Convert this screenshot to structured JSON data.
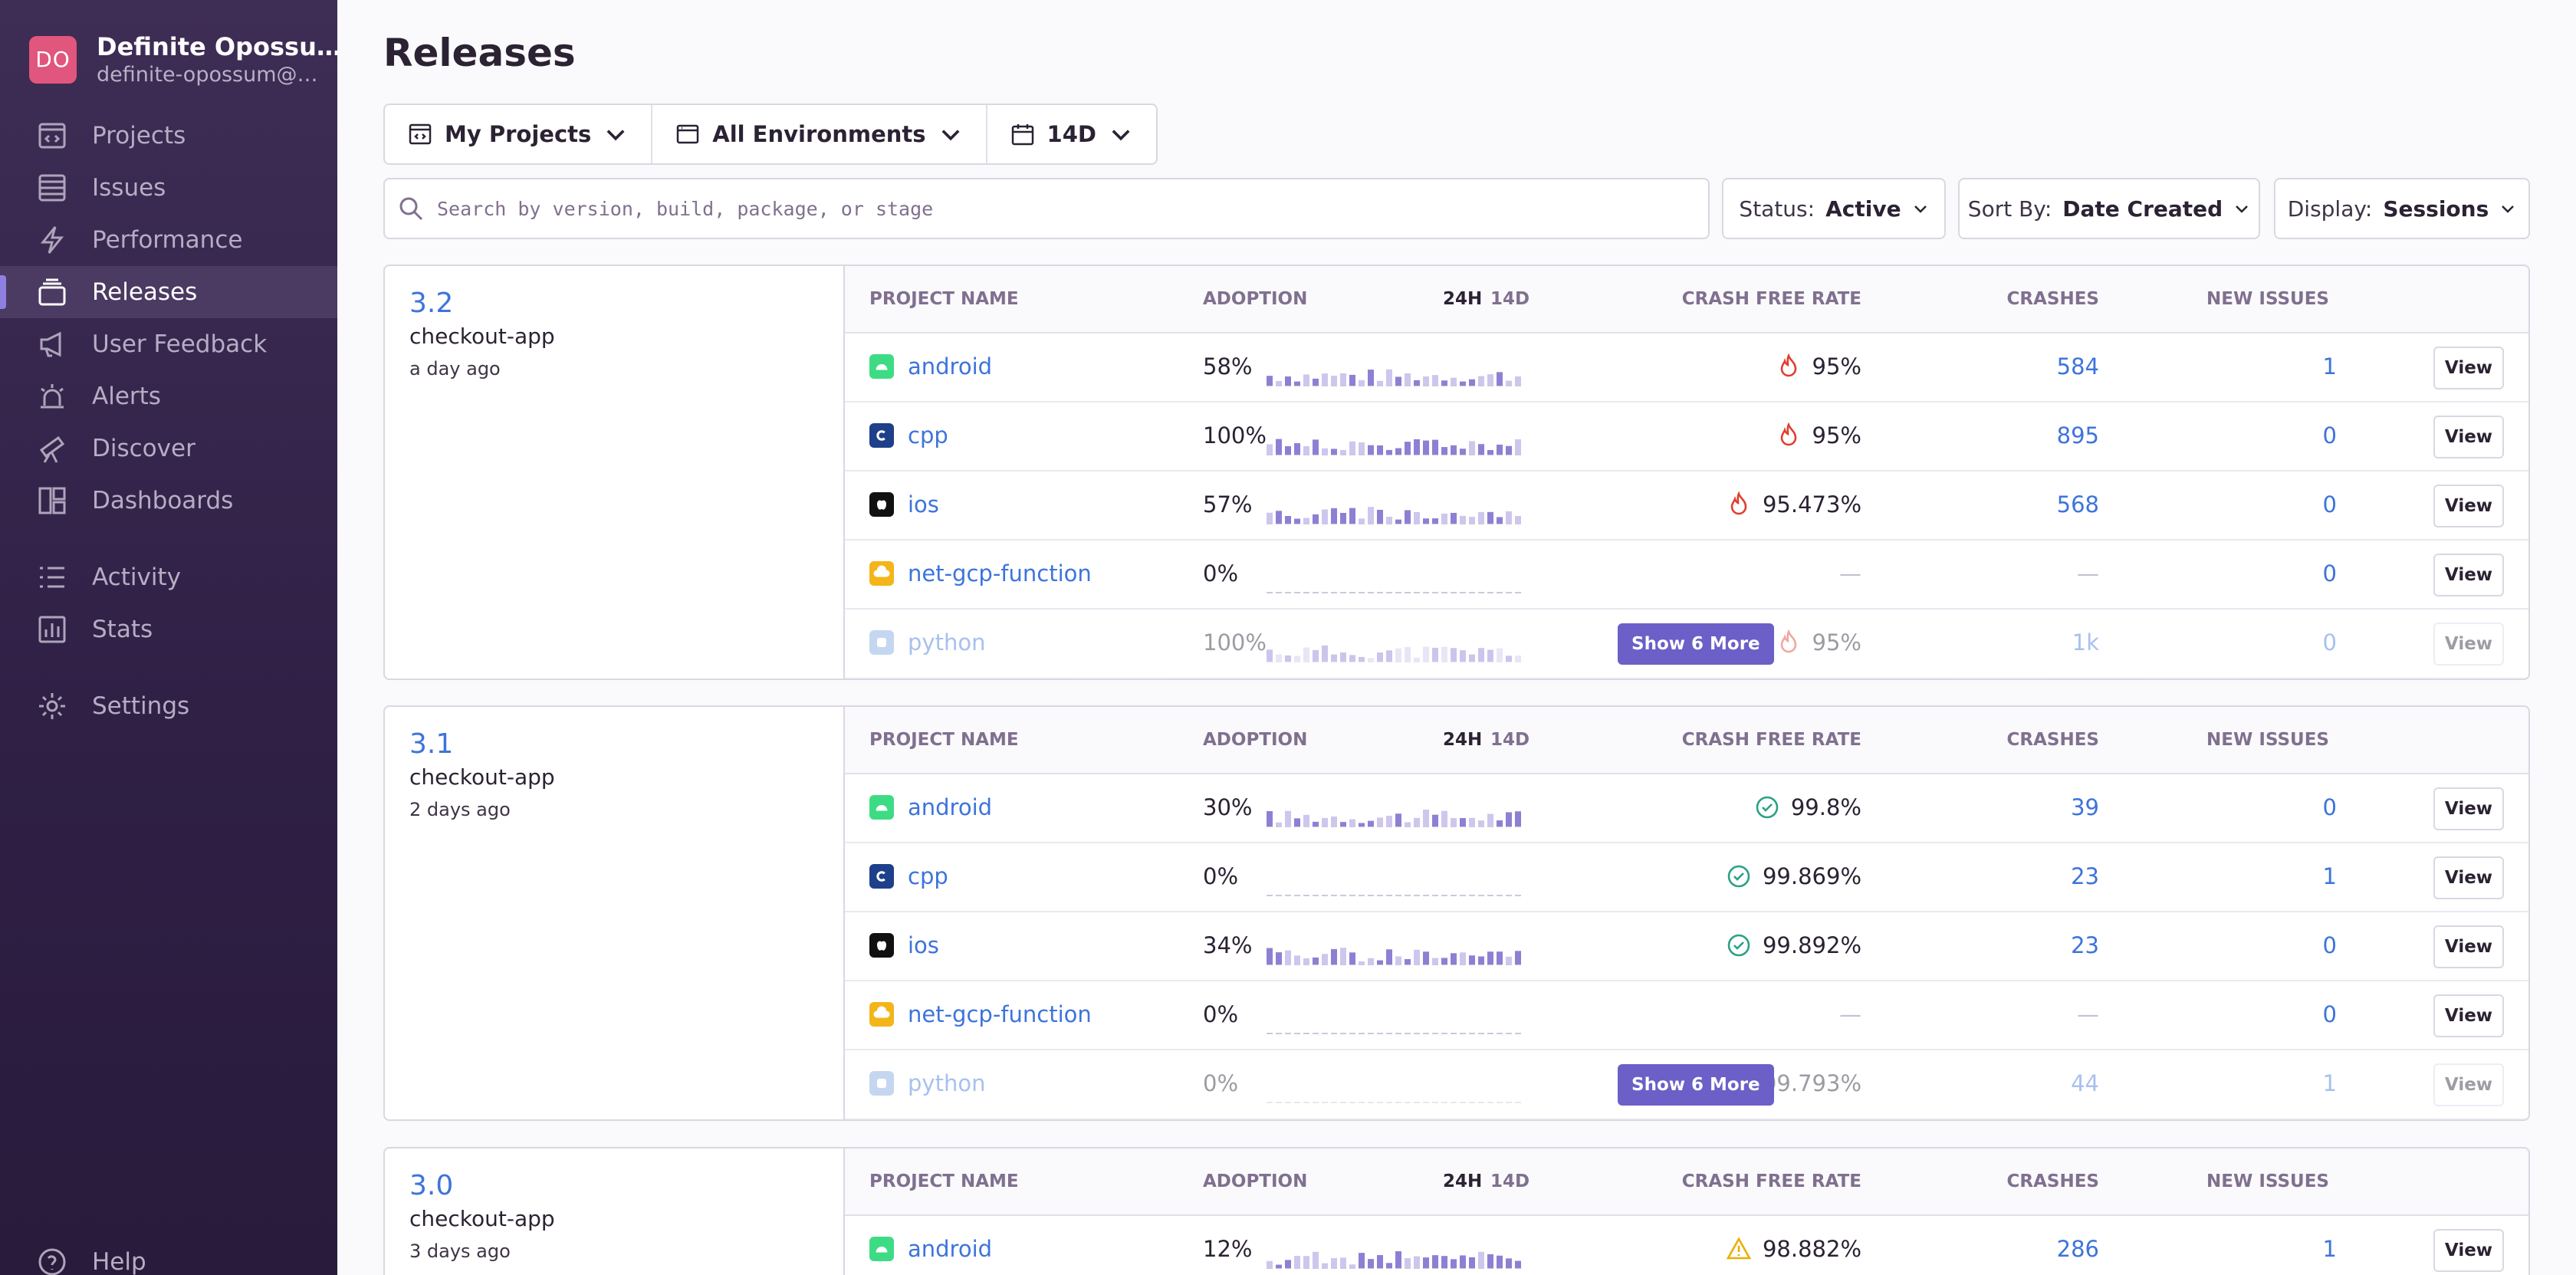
{
  "org": {
    "initials": "DO",
    "name": "Definite Opossu…",
    "email": "definite-opossum@…"
  },
  "nav": {
    "projects": "Projects",
    "issues": "Issues",
    "performance": "Performance",
    "releases": "Releases",
    "user_feedback": "User Feedback",
    "alerts": "Alerts",
    "discover": "Discover",
    "dashboards": "Dashboards",
    "activity": "Activity",
    "stats": "Stats",
    "settings": "Settings",
    "help": "Help"
  },
  "page": {
    "title": "Releases"
  },
  "filters": {
    "projects": "My Projects",
    "environments": "All Environments",
    "period": "14D"
  },
  "search": {
    "placeholder": "Search by version, build, package, or stage"
  },
  "status": {
    "label": "Status:",
    "value": "Active"
  },
  "sort": {
    "label": "Sort By:",
    "value": "Date Created"
  },
  "display": {
    "label": "Display:",
    "value": "Sessions"
  },
  "table_headers": {
    "project_name": "PROJECT NAME",
    "adoption": "ADOPTION",
    "h24": "24H",
    "d14": "14D",
    "crash_free_rate": "CRASH FREE RATE",
    "crashes": "CRASHES",
    "new_issues": "NEW ISSUES"
  },
  "view_label": "View",
  "show_more_label": "Show 6 More",
  "colors": {
    "accent": "#6c5fc7",
    "link": "#3d74db",
    "error": "#e03e2f",
    "success": "#2ba185",
    "warning": "#e9b000"
  },
  "releases": [
    {
      "version": "3.2",
      "app": "checkout-app",
      "ago": "a day ago",
      "projects": [
        {
          "name": "android",
          "icon": "android-icon",
          "adoption": "58%",
          "crash_free": "95%",
          "status": "fire",
          "crashes": "584",
          "new_issues": "1"
        },
        {
          "name": "cpp",
          "icon": "cpp-icon",
          "adoption": "100%",
          "crash_free": "95%",
          "status": "fire",
          "crashes": "895",
          "new_issues": "0"
        },
        {
          "name": "ios",
          "icon": "apple-icon",
          "adoption": "57%",
          "crash_free": "95.473%",
          "status": "fire",
          "crashes": "568",
          "new_issues": "0"
        },
        {
          "name": "net-gcp-function",
          "icon": "gcp-icon",
          "adoption": "0%",
          "crash_free": "—",
          "status": "none",
          "crashes": "—",
          "new_issues": "0"
        },
        {
          "name": "python",
          "icon": "python-icon",
          "adoption": "100%",
          "crash_free": "95%",
          "status": "fire",
          "crashes": "1k",
          "new_issues": "0"
        }
      ]
    },
    {
      "version": "3.1",
      "app": "checkout-app",
      "ago": "2 days ago",
      "projects": [
        {
          "name": "android",
          "icon": "android-icon",
          "adoption": "30%",
          "crash_free": "99.8%",
          "status": "ok",
          "crashes": "39",
          "new_issues": "0"
        },
        {
          "name": "cpp",
          "icon": "cpp-icon",
          "adoption": "0%",
          "crash_free": "99.869%",
          "status": "ok",
          "crashes": "23",
          "new_issues": "1"
        },
        {
          "name": "ios",
          "icon": "apple-icon",
          "adoption": "34%",
          "crash_free": "99.892%",
          "status": "ok",
          "crashes": "23",
          "new_issues": "0"
        },
        {
          "name": "net-gcp-function",
          "icon": "gcp-icon",
          "adoption": "0%",
          "crash_free": "—",
          "status": "none",
          "crashes": "—",
          "new_issues": "0"
        },
        {
          "name": "python",
          "icon": "python-icon",
          "adoption": "0%",
          "crash_free": "99.793%",
          "status": "none",
          "crashes": "44",
          "new_issues": "1"
        }
      ]
    },
    {
      "version": "3.0",
      "app": "checkout-app",
      "ago": "3 days ago",
      "projects": [
        {
          "name": "android",
          "icon": "android-icon",
          "adoption": "12%",
          "crash_free": "98.882%",
          "status": "warn",
          "crashes": "286",
          "new_issues": "1"
        }
      ]
    }
  ]
}
